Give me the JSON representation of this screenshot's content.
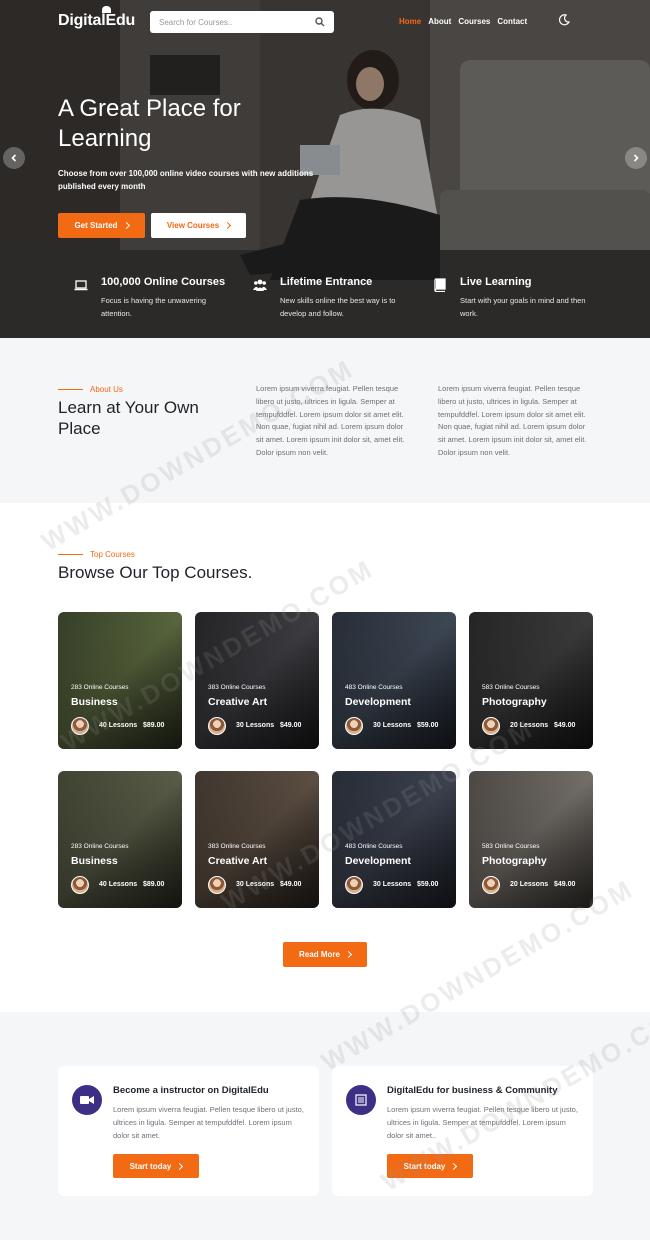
{
  "brand": {
    "name": "DigitalEdu",
    "accent": "#f26a14",
    "dark_purple": "#3d2f85"
  },
  "header": {
    "search_placeholder": "Search for Courses..",
    "nav": [
      "Home",
      "About",
      "Courses",
      "Contact"
    ]
  },
  "hero": {
    "title": "A Great Place for Learning",
    "subtitle": "Choose from over 100,000 online video courses with new additions published every month",
    "primary_button": "Get Started",
    "secondary_button": "View Courses",
    "features": [
      {
        "icon": "laptop-icon",
        "title": "100,000 Online Courses",
        "desc": "Focus is having the unwavering attention."
      },
      {
        "icon": "users-icon",
        "title": "Lifetime Entrance",
        "desc": "New skills online the best way is to develop and follow."
      },
      {
        "icon": "book-icon",
        "title": "Live Learning",
        "desc": "Start with your goals in mind and then work."
      }
    ]
  },
  "about": {
    "eyebrow": "About Us",
    "title": "Learn at Your Own Place",
    "para1": "Lorem ipsum viverra feugiat. Pellen tesque libero ut justo, ultrices in ligula. Semper at tempufddfel. Lorem ipsum dolor sit amet elit. Non quae, fugiat nihil ad. Lorem ipsum dolor sit amet. Lorem ipsum init dolor sit, amet elit. Dolor ipsum non velit.",
    "para2": "Lorem ipsum viverra feugiat. Pellen tesque libero ut justo, ultrices in ligula. Semper at tempufddfel. Lorem ipsum dolor sit amet elit. Non quae, fugiat nihil ad. Lorem ipsum dolor sit amet. Lorem ipsum init dolor sit, amet elit. Dolor ipsum non velit."
  },
  "courses": {
    "eyebrow": "Top Courses",
    "title": "Browse Our Top Courses.",
    "read_more": "Read More",
    "items": [
      {
        "count": "283 Online Courses",
        "name": "Business",
        "lessons": "40 Lessons",
        "price": "$89.00"
      },
      {
        "count": "383 Online Courses",
        "name": "Creative Art",
        "lessons": "30 Lessons",
        "price": "$49.00"
      },
      {
        "count": "483 Online Courses",
        "name": "Development",
        "lessons": "30 Lessons",
        "price": "$59.00"
      },
      {
        "count": "583 Online Courses",
        "name": "Photography",
        "lessons": "20 Lessons",
        "price": "$49.00"
      },
      {
        "count": "283 Online Courses",
        "name": "Business",
        "lessons": "40 Lessons",
        "price": "$89.00"
      },
      {
        "count": "383 Online Courses",
        "name": "Creative Art",
        "lessons": "30 Lessons",
        "price": "$49.00"
      },
      {
        "count": "483 Online Courses",
        "name": "Development",
        "lessons": "30 Lessons",
        "price": "$59.00"
      },
      {
        "count": "583 Online Courses",
        "name": "Photography",
        "lessons": "20 Lessons",
        "price": "$49.00"
      }
    ]
  },
  "cta": [
    {
      "icon": "video-icon",
      "title": "Become a instructor on DigitalEdu",
      "desc": "Lorem ipsum viverra feugiat. Pellen tesque libero ut justo, ultrices in ligula. Semper at tempufddfel. Lorem ipsum dolor sit amet.",
      "button": "Start today"
    },
    {
      "icon": "building-icon",
      "title": "DigitalEdu for business & Community",
      "desc": "Lorem ipsum viverra feugiat. Pellen tesque libero ut justo, ultrices in ligula. Semper at tempufddfel. Lorem ipsum dolor sit amet..",
      "button": "Start today"
    }
  ],
  "watermark": "WWW.DOWNDEMO.COM"
}
